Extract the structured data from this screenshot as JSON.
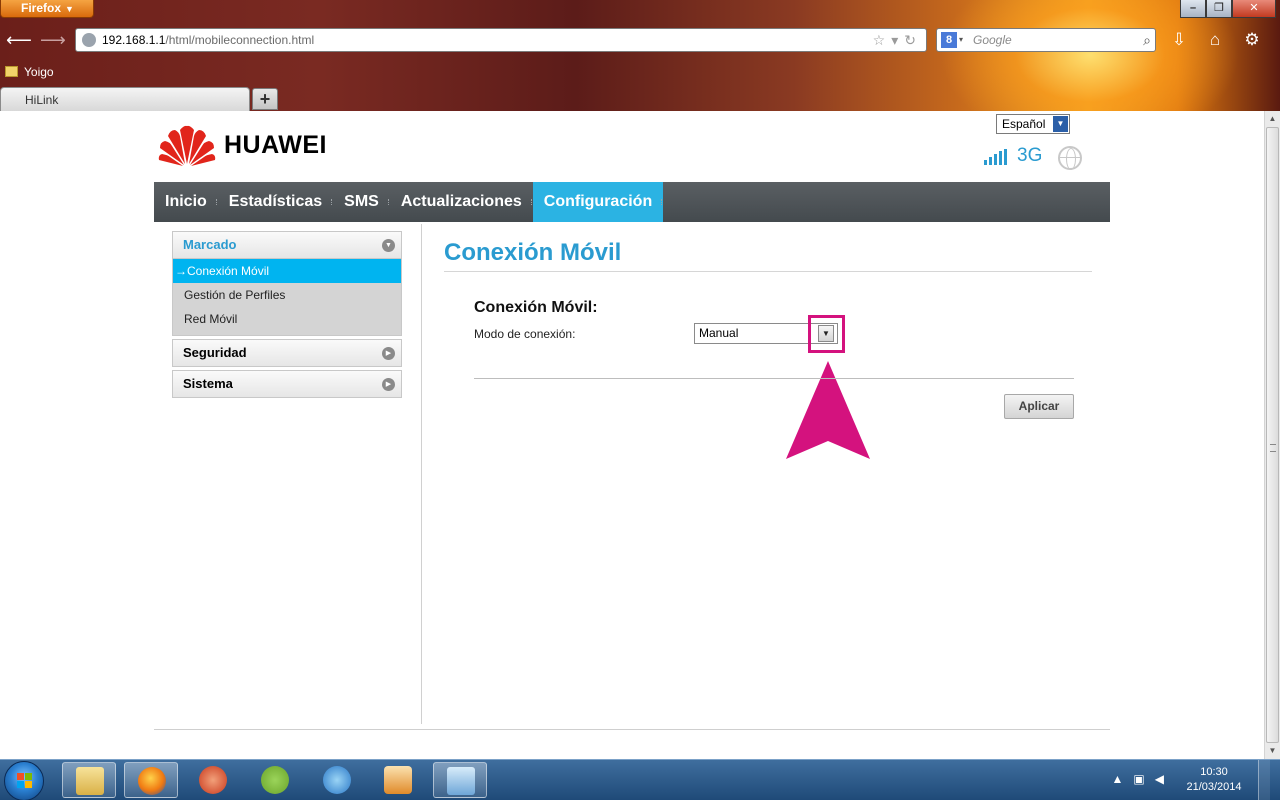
{
  "browser": {
    "app_button": "Firefox",
    "url_host": "192.168.1.1",
    "url_path": "/html/mobileconnection.html",
    "search_placeholder": "Google",
    "bookmark": "Yoigo",
    "tab_title": "HiLink",
    "new_tab": "+"
  },
  "header": {
    "language": "Español",
    "brand": "HUAWEI",
    "network_type": "3G"
  },
  "menu": {
    "items": [
      {
        "label": "Inicio"
      },
      {
        "label": "Estadísticas"
      },
      {
        "label": "SMS"
      },
      {
        "label": "Actualizaciones"
      },
      {
        "label": "Configuración"
      }
    ],
    "active_index": 4
  },
  "sidebar": {
    "groups": [
      {
        "label": "Marcado",
        "expanded": true,
        "items": [
          {
            "label": "→Conexión Móvil",
            "active": true
          },
          {
            "label": "Gestión de Perfiles"
          },
          {
            "label": "Red Móvil"
          }
        ]
      },
      {
        "label": "Seguridad",
        "expanded": false
      },
      {
        "label": "Sistema",
        "expanded": false
      }
    ]
  },
  "content": {
    "title": "Conexión Móvil",
    "section_title": "Conexión Móvil:",
    "mode_label": "Modo de conexión:",
    "mode_value": "Manual",
    "apply_label": "Aplicar"
  },
  "annotation": {
    "color": "#d4127e"
  },
  "taskbar": {
    "time": "10:30",
    "date": "21/03/2014"
  },
  "colors": {
    "accent": "#2bb3e3",
    "title": "#2a9bd0",
    "menu_bg": "#4f5458"
  }
}
